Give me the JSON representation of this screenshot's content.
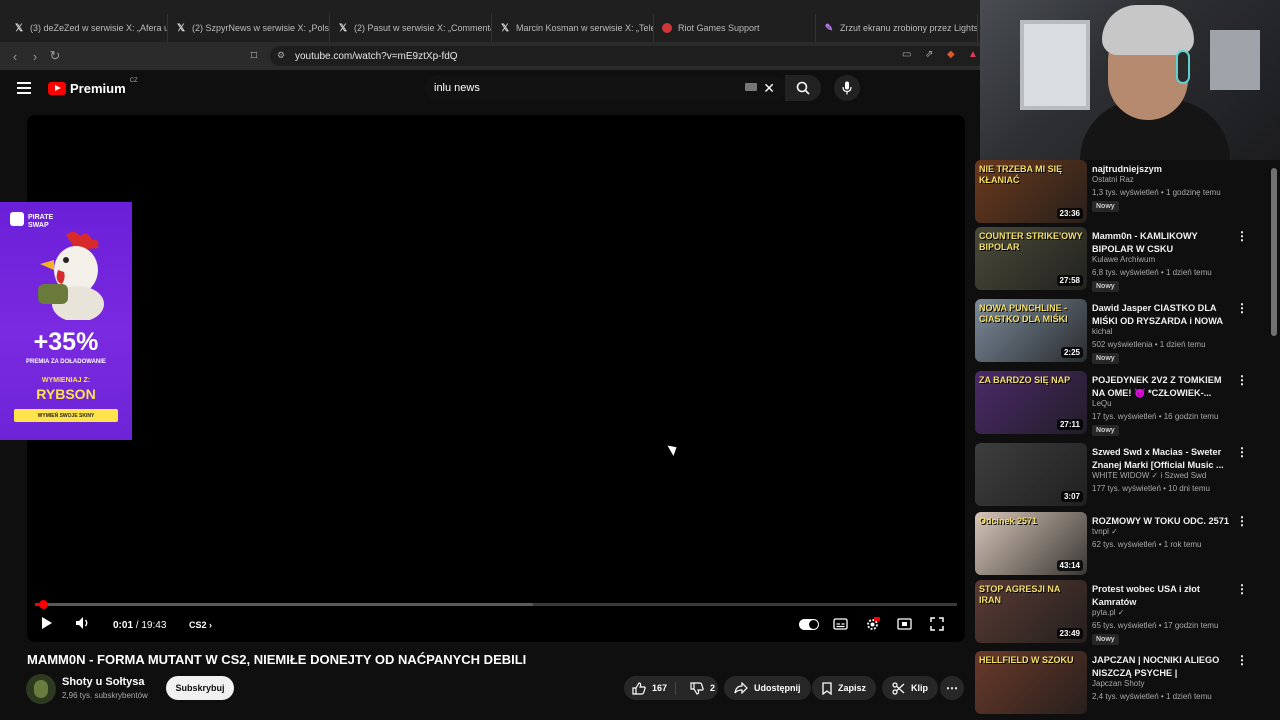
{
  "browser": {
    "tabs": [
      {
        "icon": "x-logo-icon",
        "label": "(3) deZeZed w serwisie X: „Afera u K"
      },
      {
        "icon": "x-logo-icon",
        "label": "(2) SzpyrNews w serwisie X: „Polski s"
      },
      {
        "icon": "x-logo-icon",
        "label": "(2) Pasut w serwisie X: „Commentary"
      },
      {
        "icon": "x-logo-icon",
        "label": "Marcin Kosman w serwisie X: „Telewi"
      },
      {
        "icon": "riot-icon",
        "label": "Riot Games Support"
      },
      {
        "icon": "pen-icon",
        "label": "Zrzut ekranu zrobiony przez Lightsh"
      }
    ],
    "url": "youtube.com/watch?v=mE9ztXp-fdQ"
  },
  "header": {
    "logo_text": "Premium",
    "logo_country": "CZ",
    "search_value": "inlu news"
  },
  "player": {
    "time_current": "0:01",
    "time_separator": "/",
    "time_total": "19:43",
    "chapter": "CS2",
    "progress_fraction": 0.001
  },
  "ad": {
    "brand_line1": "PIRATE",
    "brand_line2": "SWAP",
    "headline": "+35%",
    "subline": "PREMIA ZA DOŁADOWANIE",
    "exchange": "WYMIENIAJ Z:",
    "name": "RYBSON",
    "cta": "WYMIEŃ SWOJE SKINY"
  },
  "video": {
    "title": "MAMM0N - FORMA MUTANT W CS2, NIEMIŁE DONEJTY OD NAĆPANYCH DEBILI",
    "channel": "Shoty u Sołtysa",
    "subscribers": "2,96 tys. subskrybentów",
    "subscribe_label": "Subskrybuj",
    "likes": "167",
    "dislikes": "2",
    "share_label": "Udostępnij",
    "save_label": "Zapisz",
    "clip_label": "Klip"
  },
  "sidebar": {
    "items": [
      {
        "title": "najtrudniejszym",
        "channel": "Ostatni Raz",
        "meta": "1,3 tys. wyświetleń • 1 godzinę temu",
        "badge": "Nowy",
        "duration": "23:36",
        "thumb_color": "#6b3a1d",
        "thumb_text": "NIE TRZEBA MI SIĘ KŁANIAĆ"
      },
      {
        "title": "Mamm0n - KAMLIKOWY BIPOLAR W CSKU",
        "channel": "Kulawe Archiwum",
        "meta": "6,8 tys. wyświetleń • 1 dzień temu",
        "badge": "Nowy",
        "duration": "27:58",
        "thumb_color": "#4a4a3a",
        "thumb_text": "COUNTER STRIKE'OWY BIPOLAR"
      },
      {
        "title": "Dawid Jasper  CIASTKO DLA MIŚKI OD RYSZARDA i NOWA ...",
        "channel": "kichal",
        "meta": "502 wyświetlenia • 1 dzień temu",
        "badge": "Nowy",
        "duration": "2:25",
        "thumb_color": "#7b8a9a",
        "thumb_text": "NOWA PUNCHLINE - CIASTKO DLA MIŚKI"
      },
      {
        "title": "POJEDYNEK 2V2 Z TOMKIEM NA OME! 😈 *CZŁOWIEK-...",
        "channel": "LeQu",
        "meta": "17 tys. wyświetleń • 16 godzin temu",
        "badge": "Nowy",
        "duration": "27:11",
        "thumb_color": "#4b2a6a",
        "thumb_text": "ZA BARDZO SIĘ NAP"
      },
      {
        "title": "Szwed Swd x Macias - Sweter Znanej Marki [Official Music ...",
        "channel": "WHITE WIDOW ✓ i Szwed Swd",
        "meta": "177 tys. wyświetleń • 10 dni temu",
        "badge": "",
        "duration": "3:07",
        "thumb_color": "#3e3e3e",
        "thumb_text": ""
      },
      {
        "title": "ROZMOWY W TOKU ODC. 2571",
        "channel": "tvnpl ✓",
        "meta": "62 tys. wyświetleń • 1 rok temu",
        "badge": "",
        "duration": "43:14",
        "thumb_color": "#d7c6b8",
        "thumb_text": "Odcinek 2571"
      },
      {
        "title": "Protest wobec USA i złot Kamratów",
        "channel": "pyta.pl ✓",
        "meta": "65 tys. wyświetleń • 17 godzin temu",
        "badge": "Nowy",
        "duration": "23:49",
        "thumb_color": "#5a3b34",
        "thumb_text": "STOP AGRESJI NA IRAN"
      },
      {
        "title": "JAPCZAN | NOCNIKI ALIEGO NISZCZĄ PSYCHE |",
        "channel": "Japczan Shoty",
        "meta": "2,4 tys. wyświetleń • 1 dzień temu",
        "badge": "",
        "duration": "",
        "thumb_color": "#6a3a2a",
        "thumb_text": "HELLFIELD W SZOKU"
      }
    ]
  },
  "colors": {
    "accent": "#ff0000",
    "background": "#0f0f0f",
    "ad_purple": "#6a1fd8",
    "ad_yellow": "#ffe34d"
  }
}
